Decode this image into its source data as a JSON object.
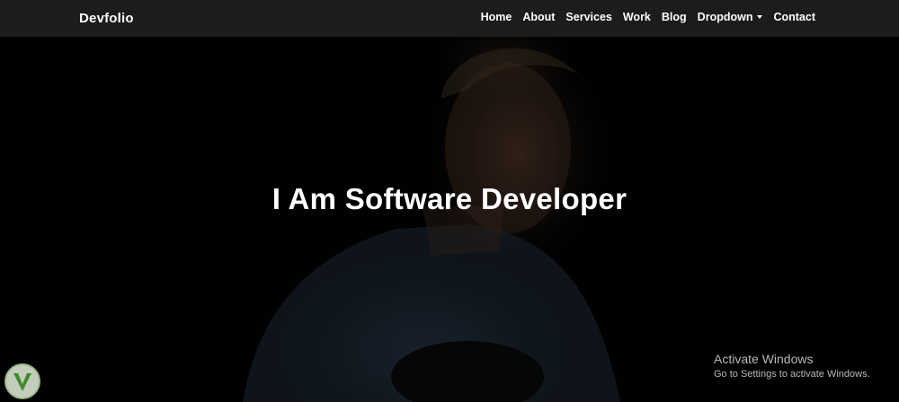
{
  "navbar": {
    "brand": "Devfolio",
    "links": [
      {
        "label": "Home"
      },
      {
        "label": "About"
      },
      {
        "label": "Services"
      },
      {
        "label": "Work"
      },
      {
        "label": "Blog"
      },
      {
        "label": "Dropdown",
        "icon": "chevron-down-icon"
      },
      {
        "label": "Contact"
      }
    ]
  },
  "hero": {
    "title": "I Am Software Developer"
  },
  "watermark": {
    "title": "Activate Windows",
    "subtitle": "Go to Settings to activate Windows."
  },
  "colors": {
    "navbar_bg": "#1e1e1e",
    "text": "#ffffff",
    "watermark_text": "#b8b8b8"
  }
}
